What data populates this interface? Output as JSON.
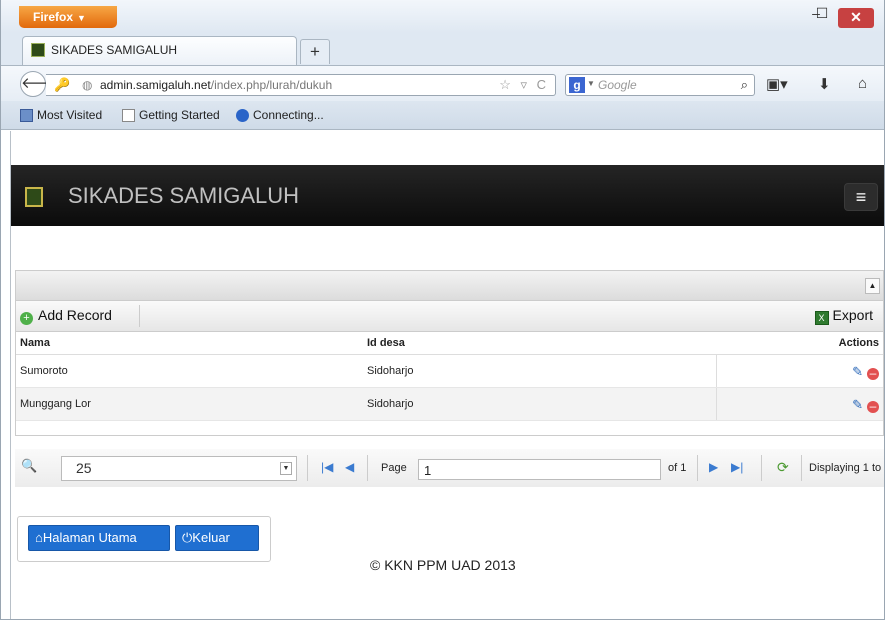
{
  "browser": {
    "menu_label": "Firefox",
    "tab_title": "SIKADES SAMIGALUH",
    "url_host": "admin.samigaluh.net",
    "url_path": "/index.php/lurah/dukuh",
    "url_prefix": "",
    "search_placeholder": "Google",
    "bookmarks": [
      "Most Visited",
      "Getting Started",
      "Connecting..."
    ]
  },
  "app": {
    "title": "SIKADES SAMIGALUH"
  },
  "grid": {
    "add_label": "Add Record",
    "export_label": "Export",
    "columns": [
      "Nama",
      "Id desa",
      "Actions"
    ],
    "rows": [
      {
        "nama": "Sumoroto",
        "id_desa": "Sidoharjo"
      },
      {
        "nama": "Munggang Lor",
        "id_desa": "Sidoharjo"
      }
    ],
    "pager": {
      "page_size": "25",
      "page_label": "Page",
      "page_value": "1",
      "of_label": "of 1",
      "displaying": "Displaying 1 to"
    }
  },
  "buttons": {
    "home": "Halaman Utama",
    "logout": "Keluar"
  },
  "footer": "© KKN PPM UAD 2013",
  "colors": {
    "primary_button": "#1f6fd1",
    "appbar": "#111111",
    "firefox_orange": "#e8790f"
  }
}
